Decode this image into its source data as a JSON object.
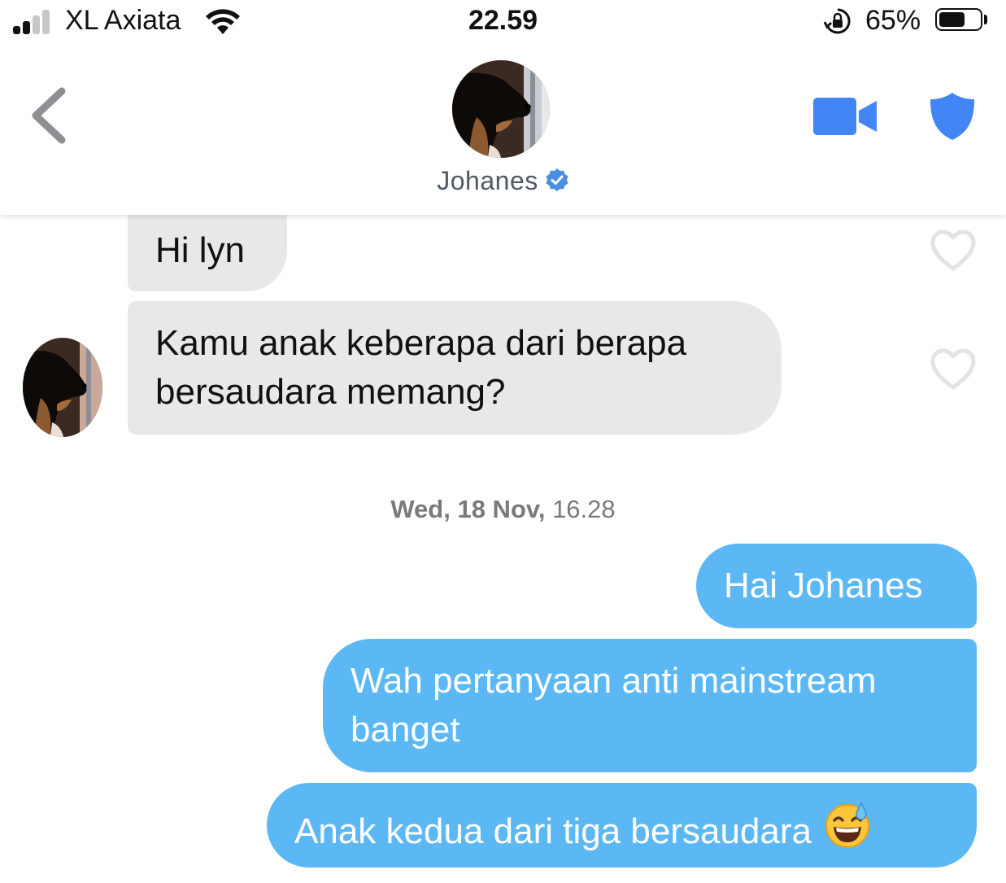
{
  "status_bar": {
    "carrier": "XL Axiata",
    "time": "22.59",
    "battery_percent": "65%",
    "battery_level": 0.65,
    "signal_bars_active": 2,
    "signal_bars_total": 4
  },
  "header": {
    "contact_name": "Johanes",
    "verified": true,
    "icons": [
      "back-chevron-icon",
      "video-call-icon",
      "safety-shield-icon",
      "verified-badge-icon"
    ]
  },
  "messages": {
    "m1": "Hi lyn",
    "m2_line1": "Kamu anak keberapa dari berapa",
    "m2_line2": "bersaudara memang?",
    "timestamp_day": "Wed, 18 Nov,",
    "timestamp_time": "16.28",
    "m3": "Hai Johanes",
    "m4_line1": "Wah pertanyaan anti mainstream",
    "m4_line2": "banget",
    "m5": "Anak kedua dari tiga bersaudara"
  },
  "colors": {
    "accent_blue": "#4285f4",
    "outgoing_bubble": "#5cb8f5",
    "incoming_bubble": "#e8e8e8",
    "heart_outline": "#e3e3e3"
  }
}
